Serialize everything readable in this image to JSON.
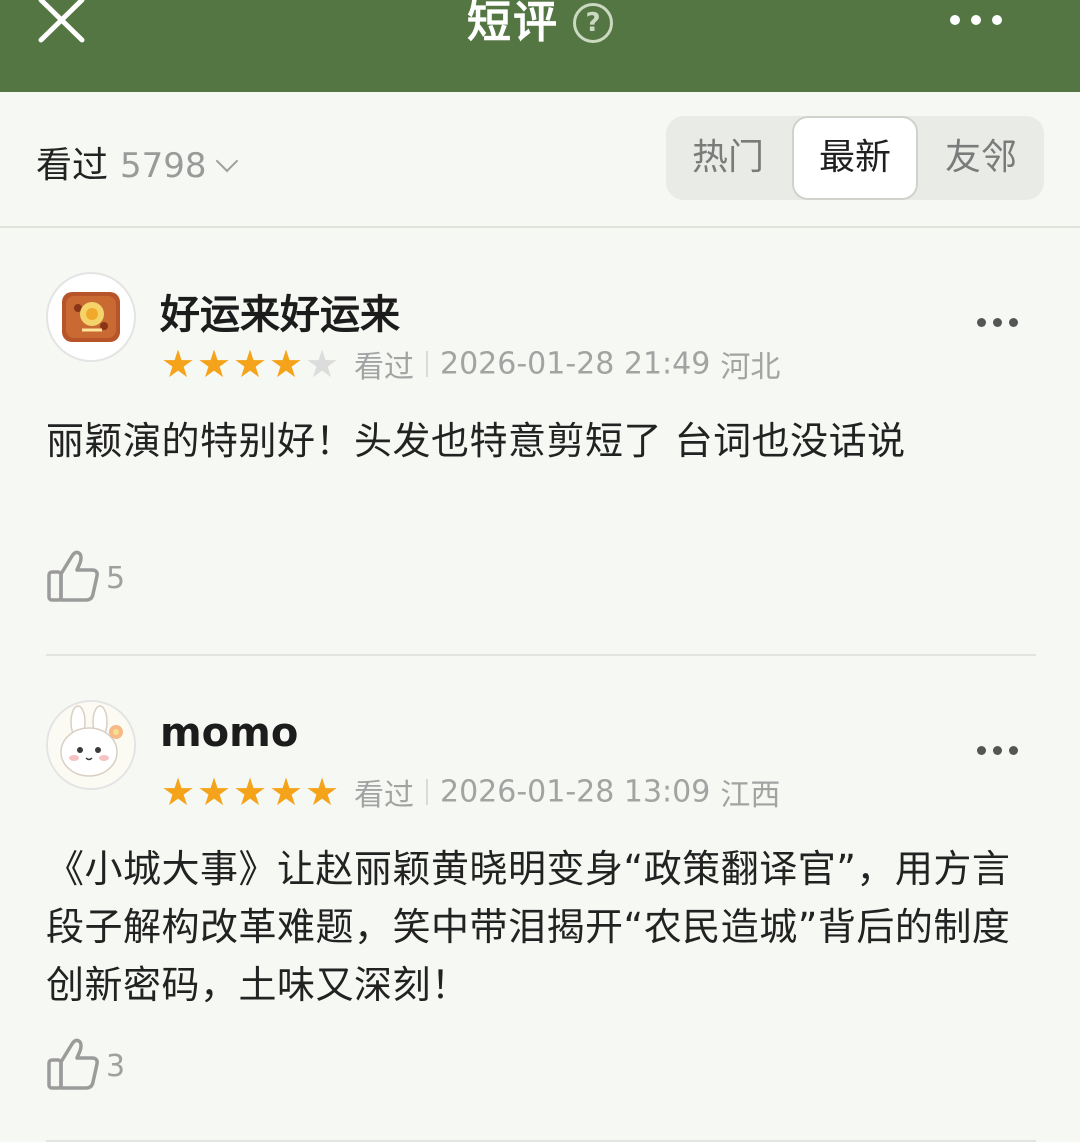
{
  "header": {
    "title": "短评",
    "help_symbol": "?",
    "close_icon": "close-icon",
    "more_icon": "more-horizontal-icon",
    "bar_color": "#537642"
  },
  "filter": {
    "seen_label": "看过",
    "seen_count": "5798",
    "tabs": [
      {
        "label": "热门",
        "active": false
      },
      {
        "label": "最新",
        "active": true
      },
      {
        "label": "友邻",
        "active": false
      }
    ]
  },
  "reviews": [
    {
      "username": "好运来好运来",
      "rating": 4,
      "max_rating": 5,
      "status": "看过",
      "datetime": "2026-01-28 21:49",
      "location": "河北",
      "content": "丽颖演的特别好！头发也特意剪短了 台词也没话说",
      "likes": "5",
      "avatar": "toast-avatar"
    },
    {
      "username": "momo",
      "rating": 5,
      "max_rating": 5,
      "status": "看过",
      "datetime": "2026-01-28 13:09",
      "location": "江西",
      "content": "《小城大事》让赵丽颖黄晓明变身“政策翻译官”，用方言段子解构改革难题，笑中带泪揭开“农民造城”背后的制度创新密码，土味又深刻！",
      "likes": "3",
      "avatar": "bunny-avatar"
    }
  ],
  "colors": {
    "star": "#f5a31a",
    "star_off": "#dcdcdc",
    "meta_text": "#a3a3a3"
  }
}
